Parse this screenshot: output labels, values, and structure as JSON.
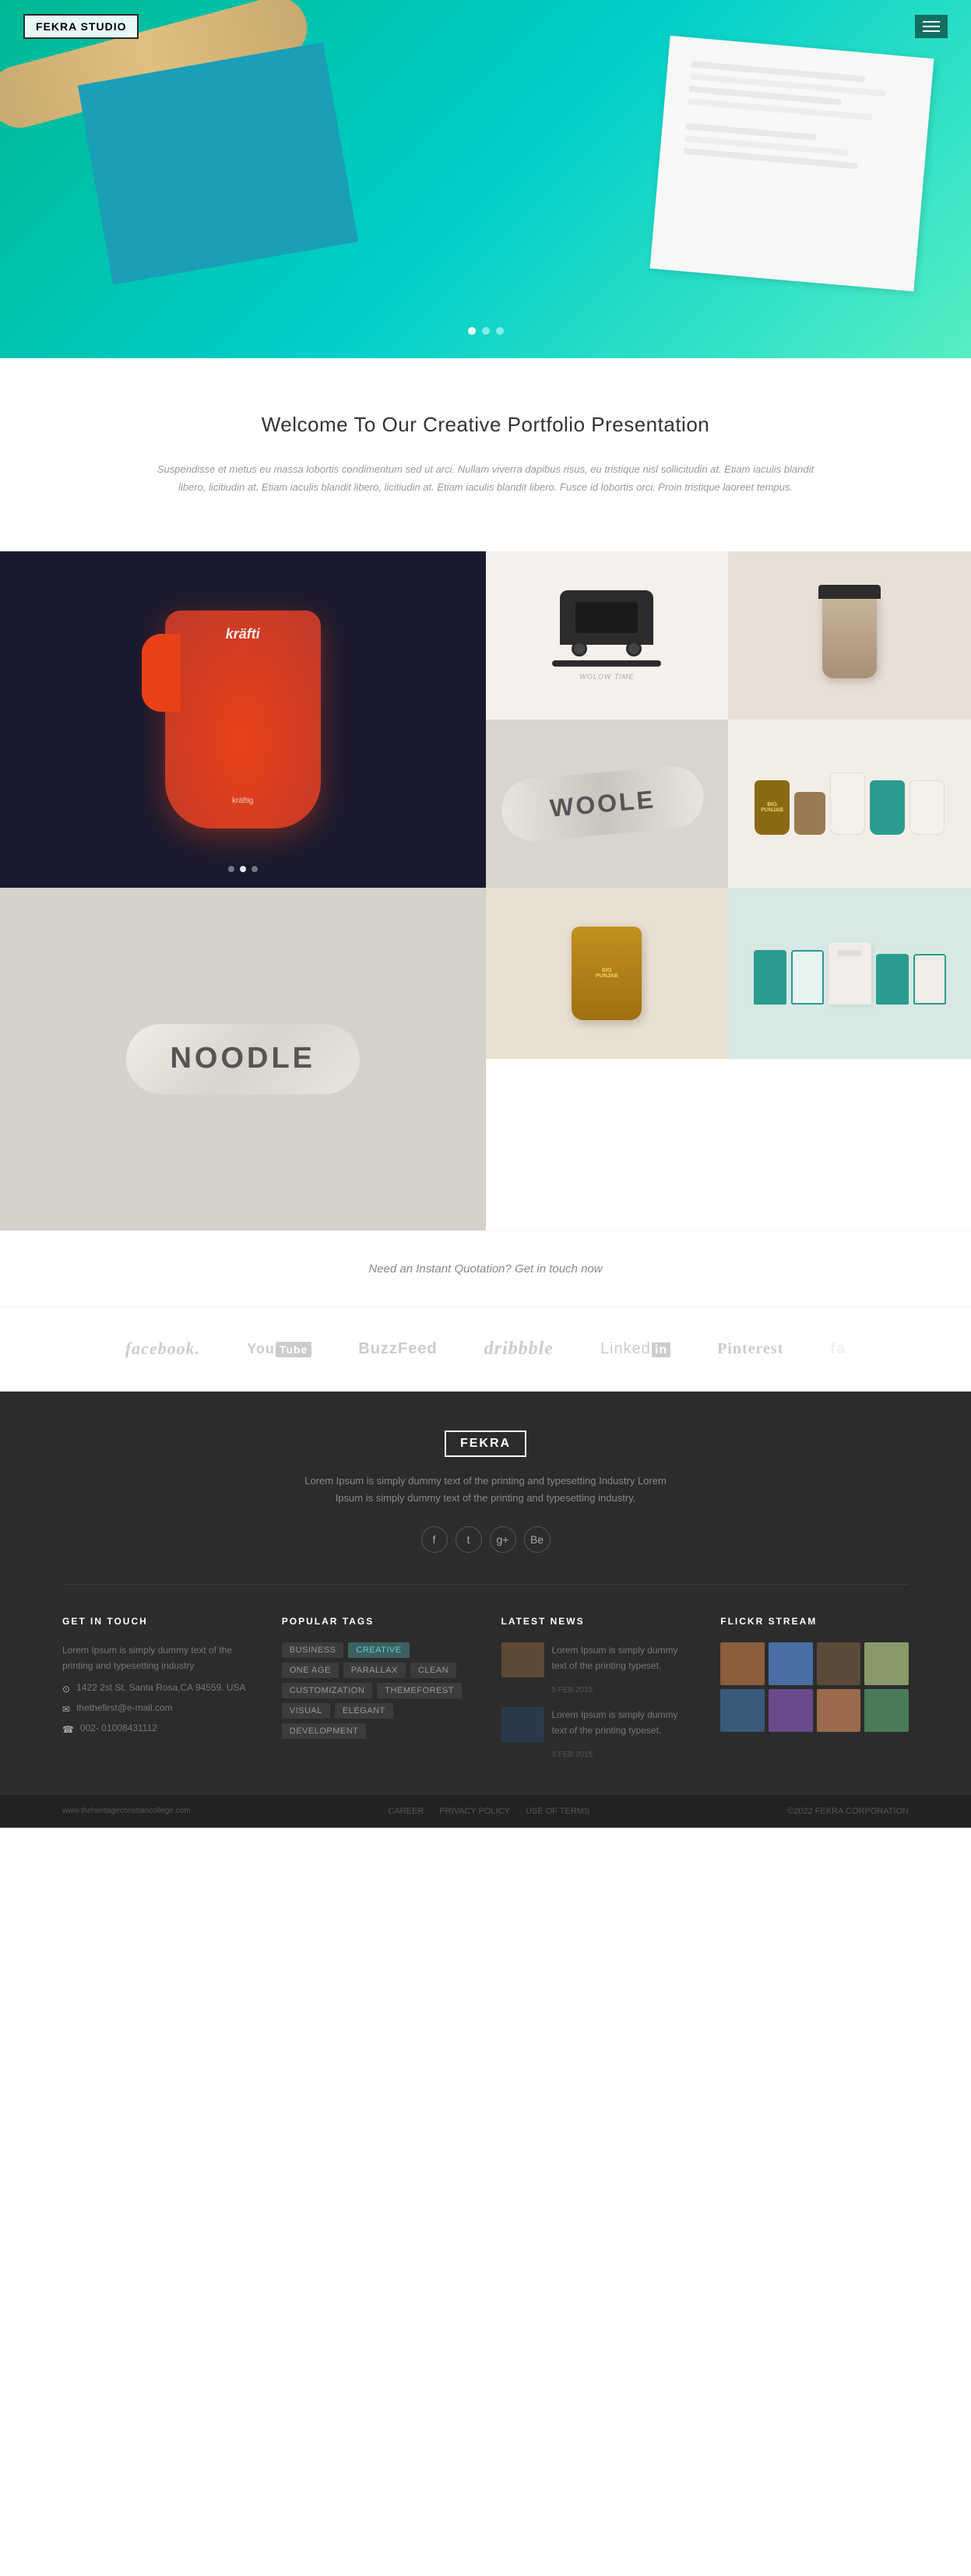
{
  "header": {
    "logo": "FEKRA STUDIO",
    "menu_label": "menu"
  },
  "hero": {
    "dots": [
      {
        "active": true
      },
      {
        "active": false
      },
      {
        "active": false
      }
    ]
  },
  "welcome": {
    "title": "Welcome To Our Creative Portfolio Presentation",
    "body": "Suspendisse et metus eu massa lobortis condimentum sed ut arci. Nullam viverra dapibus risus, eu tristique nisl sollicitudin at. Etiam iaculis blandit libero, licitiudin at. Etiam iaculis blandit libero, licitiudin at. Etiam iaculis blandit libero. Fusce id lobortis orci. Proin tristique laoreet tempus."
  },
  "portfolio": {
    "item1_label": "kräftig",
    "dots": [
      {
        "active": false
      },
      {
        "active": true
      },
      {
        "active": false
      }
    ]
  },
  "quotation": {
    "text": "Need an Instant Quotation? Get in touch now"
  },
  "social_logos": [
    {
      "name": "facebook",
      "label": "facebook."
    },
    {
      "name": "youtube",
      "label": "YouTube"
    },
    {
      "name": "buzzfeed",
      "label": "BuzzFeed"
    },
    {
      "name": "dribbble",
      "label": "dribbble"
    },
    {
      "name": "linkedin",
      "label": "LinkedIn"
    },
    {
      "name": "pinterest",
      "label": "Pinterest"
    },
    {
      "name": "fa",
      "label": "fa"
    }
  ],
  "footer": {
    "logo": "FEKRA",
    "description": "Lorem Ipsum is simply dummy text of the printing and typesetting Industry Lorem Ipsum is simply dummy text of the printing and typesetting industry.",
    "social_icons": [
      "f",
      "t",
      "g+",
      "Be"
    ],
    "columns": {
      "get_in_touch": {
        "title": "GET IN TOUCH",
        "description": "Lorem Ipsum is simply dummy text of the printing and typesetting industry",
        "address": "1422 2st St. Santa Rosa,CA 94559. USA",
        "email": "thethefirst@e-mail.com",
        "phone": "002- 01008431112"
      },
      "popular_tags": {
        "title": "POPULAR TAGS",
        "tags": [
          "BUSINESS",
          "CREATIVE",
          "ONE AGE",
          "PARALLAX",
          "CLEAN",
          "CUSTOMIZATION",
          "THEMEFOREST",
          "VISUAL",
          "ELEGANT",
          "DEVELOPMENT"
        ]
      },
      "latest_news": {
        "title": "LATEST NEWS",
        "items": [
          {
            "text": "Lorem Ipsum is simply dummy text of the printing typeset.",
            "date": "5 FEB 2015"
          },
          {
            "text": "Lorem Ipsum is simply dummy text of the printing typeset.",
            "date": "3 FEB 2015"
          }
        ]
      },
      "flickr_stream": {
        "title": "FLICKR STREAM"
      }
    }
  },
  "footer_bottom": {
    "links": [
      "CAREER",
      "PRIVACY POLICY",
      "USE OF TERMS"
    ],
    "copyright": "©2022 FEKRA CORPORATION"
  }
}
